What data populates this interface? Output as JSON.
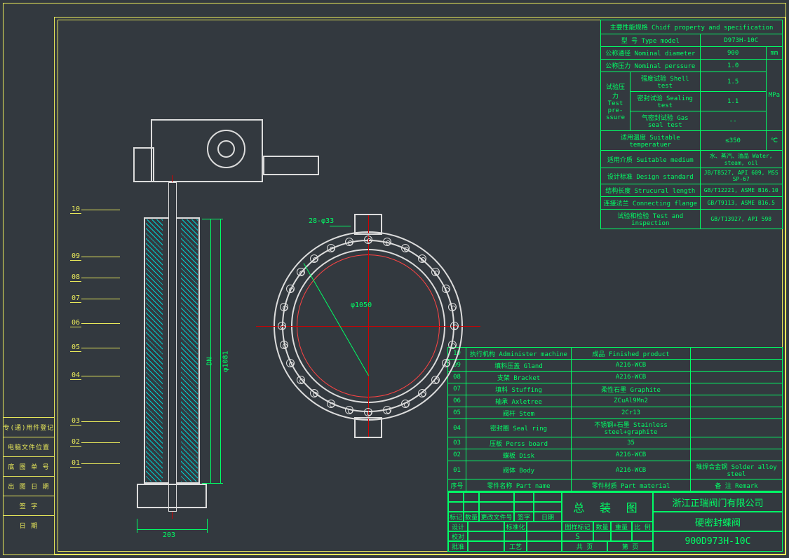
{
  "left_labels": {
    "approved": "专(通)用件登记",
    "file_pos": "电脑文件位置",
    "bom": "底 图 单 号",
    "issue_date": "出 图 日 期",
    "sign": "签     字",
    "date": "日     期"
  },
  "specs": {
    "title": "主要性能规格 Chidf property and specification",
    "type_model_label": "型 号  Type model",
    "type_model": "D973H-10C",
    "nd_label": "公称通径 Nominal diameter",
    "nd": "900",
    "nd_unit": "mm",
    "np_label": "公称压力 Nominal perssure",
    "np": "1.0",
    "tp_group": "试验压力\nTest pre-\nssure",
    "shell_label": "强度试验 Shell test",
    "shell": "1.5",
    "seal_label": "密封试验 Sealing test",
    "seal": "1.1",
    "gas_label": "气密封试验 Gas seal test",
    "gas": "--",
    "p_unit": "MPa",
    "temp_label": "适用温度 Suitable temperatuer",
    "temp": "≤350",
    "temp_unit": "℃",
    "medium_label": "适用介质 Suitable medium",
    "medium": "水、蒸汽、油品 Water, steam, oil",
    "design_label": "设计标准 Design standard",
    "design": "JB/T8527, API 609, MSS SP-67",
    "struct_label": "结构长度 Strucural length",
    "struct": "GB/T12221, ASME B16.10",
    "flange_label": "连接法兰 Connecting flange",
    "flange": "GB/T9113, ASME B16.5",
    "test_label": "试验和检验 Test and inspection",
    "test": "GB/T13927, API 598"
  },
  "parts": {
    "head_num": "序号",
    "head_name": "零件名称 Part name",
    "head_mat": "零件材质 Part material",
    "head_rem": "备  注 Remark",
    "rows": [
      {
        "n": "10",
        "name": "执行机构 Administer machine",
        "mat": "成品 Finished product",
        "rem": ""
      },
      {
        "n": "09",
        "name": "填料压盖 Gland",
        "mat": "A216-WCB",
        "rem": ""
      },
      {
        "n": "08",
        "name": "支架 Bracket",
        "mat": "A216-WCB",
        "rem": ""
      },
      {
        "n": "07",
        "name": "填料 Stuffing",
        "mat": "柔性石墨 Graphite",
        "rem": ""
      },
      {
        "n": "06",
        "name": "轴承 Axletree",
        "mat": "ZCuAl9Mn2",
        "rem": ""
      },
      {
        "n": "05",
        "name": "阀杆 Stem",
        "mat": "2Cr13",
        "rem": ""
      },
      {
        "n": "04",
        "name": "密封圈 Seal ring",
        "mat": "不锈钢+石墨 Stainless steel+graphite",
        "rem": ""
      },
      {
        "n": "03",
        "name": "压板 Perss board",
        "mat": "35",
        "rem": ""
      },
      {
        "n": "02",
        "name": "蝶板 Disk",
        "mat": "A216-WCB",
        "rem": ""
      },
      {
        "n": "01",
        "name": "阀体 Body",
        "mat": "A216-WCB",
        "rem": "堆焊合金钢 Solder alloy steel"
      }
    ]
  },
  "titleblock": {
    "mark_row": "标记",
    "n_row": "数量",
    "rev": "更改文件号",
    "sig": "签字",
    "dt": "日期",
    "design": "设计",
    "stdz": "标准化",
    "check": "校对",
    "appr": "批准",
    "craft": "工艺",
    "date": "日期",
    "pattern": "图样标记",
    "qty": "数量",
    "mass": "重量",
    "scale": "比 例",
    "sheet": "共   页",
    "of": "第   页",
    "s": "S",
    "assy": "总 装 图",
    "company": "浙江正瑞阀门有限公司",
    "product": "硬密封蝶阀",
    "dwgno": "900D973H-10C"
  },
  "dims": {
    "phi1050": "φ1050",
    "holes": "28-φ33",
    "dn": "DN",
    "phi1081": "φ1081",
    "w203": "203"
  },
  "callouts": [
    "10",
    "09",
    "08",
    "07",
    "06",
    "05",
    "04",
    "03",
    "02",
    "01"
  ]
}
